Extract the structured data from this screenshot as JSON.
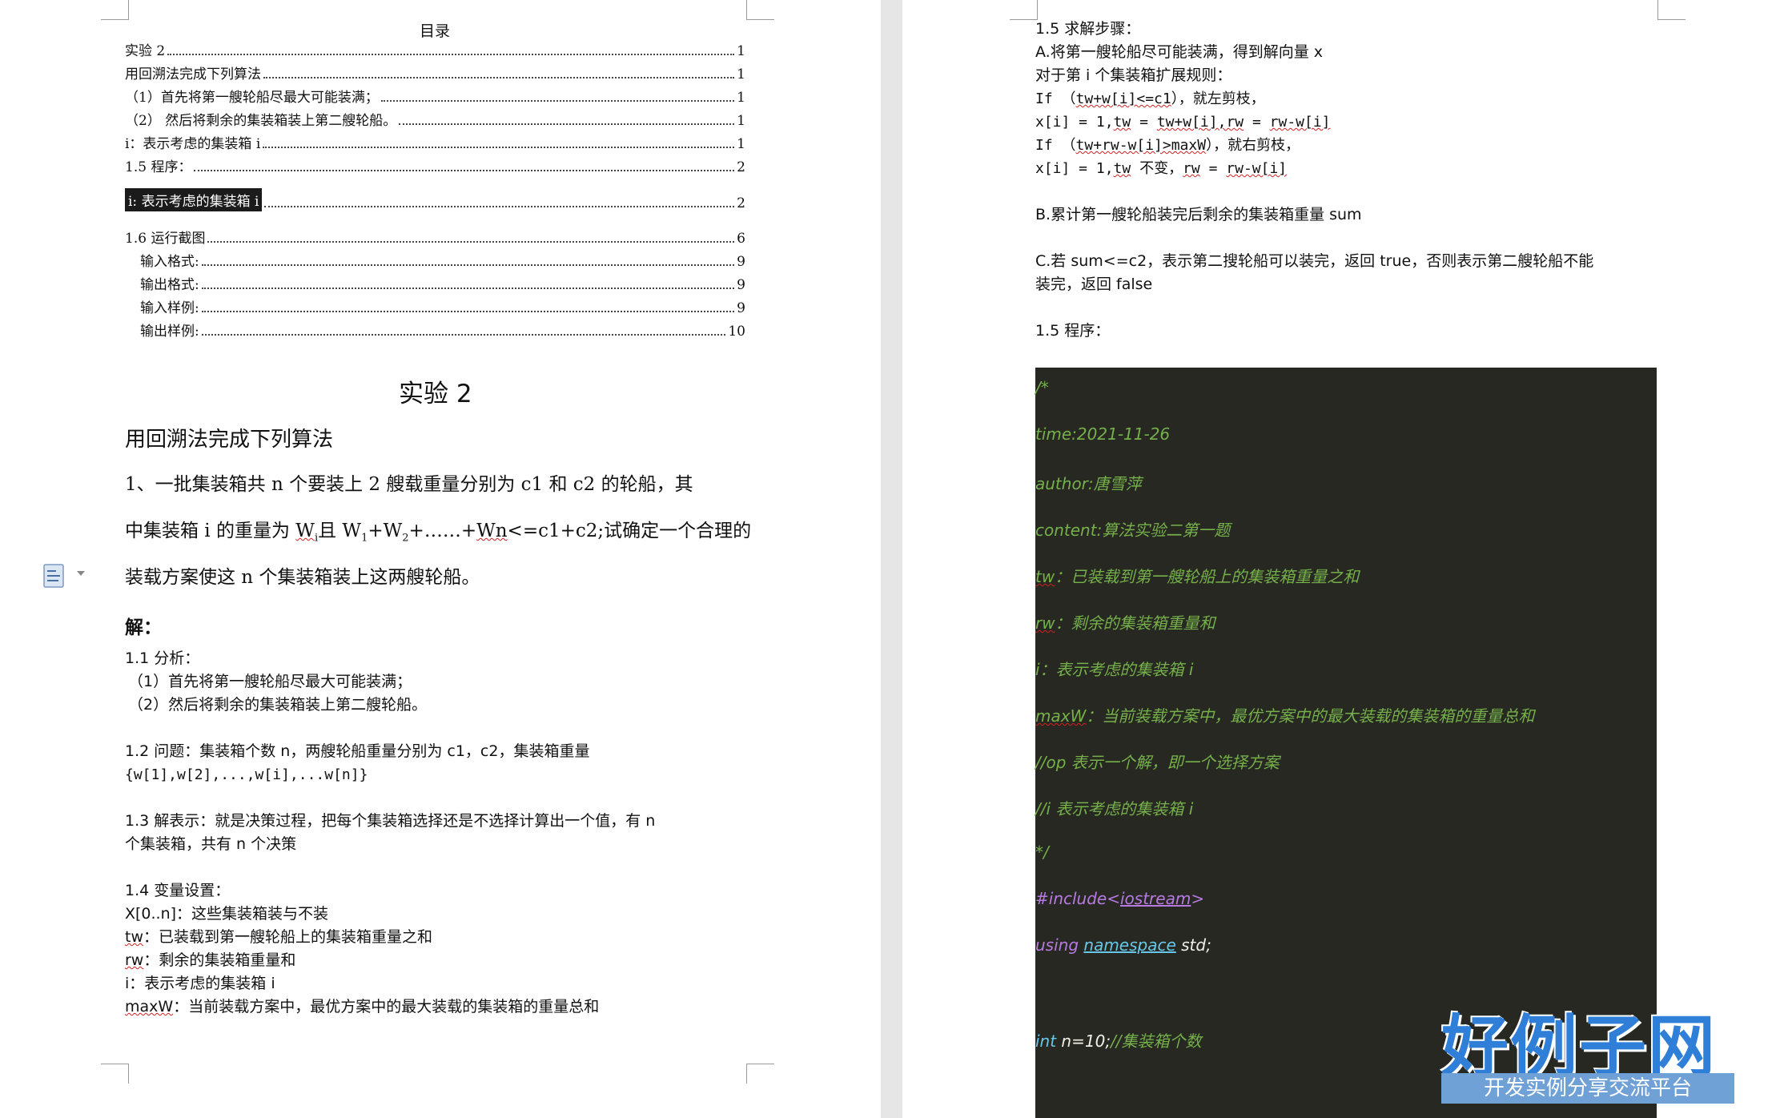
{
  "toc": {
    "title": "目录",
    "entries": [
      {
        "label": "实验 2",
        "page": "1"
      },
      {
        "label": "用回溯法完成下列算法",
        "page": "1"
      },
      {
        "label": "（1）首先将第一艘轮船尽最大可能装满；",
        "page": "1"
      },
      {
        "label": "（2） 然后将剩余的集装箱装上第二艘轮船。",
        "page": "1"
      },
      {
        "label": "i：表示考虑的集装箱 i",
        "page": "1"
      },
      {
        "label": "1.5 程序：",
        "page": "2"
      },
      {
        "label": "i: 表示考虑的集装箱 i",
        "page": "2"
      },
      {
        "label": "1.6 运行截图",
        "page": "6"
      },
      {
        "label": "输入格式:",
        "page": "9"
      },
      {
        "label": "输出格式:",
        "page": "9"
      },
      {
        "label": "输入样例:",
        "page": "9"
      },
      {
        "label": "输出样例:",
        "page": "10"
      }
    ]
  },
  "doc": {
    "h1": "实验 2",
    "h2": "用回溯法完成下列算法",
    "problem_line1": "1、一批集装箱共 n 个要装上 2 艘载重量分别为 c1 和 c2 的轮船，其",
    "problem_line2_a": "中集装箱 i 的重量为 ",
    "problem_line2_w": "W",
    "problem_line2_b": "且 W",
    "problem_line2_c": "+W",
    "problem_line2_d": "+……+",
    "problem_line2_wn": "Wn",
    "problem_line2_e": "<=c1+c2;试确定一个合理的",
    "sub_i": "i",
    "sub_1": "1",
    "sub_2": "2",
    "problem_line3": "装载方案使这 n 个集装箱装上这两艘轮船。",
    "solve": "解：",
    "s11": "1.1 分析：",
    "s11a": "（1）首先将第一艘轮船尽最大可能装满；",
    "s11b": "（2）然后将剩余的集装箱装上第二艘轮船。",
    "s12": "1.2 问题：集装箱个数 n，两艘轮船重量分别为 c1，c2，集装箱重量",
    "s12b": "{w[1],w[2],...,w[i],...w[n]}",
    "s13": "1.3 解表示：就是决策过程，把每个集装箱选择还是不选择计算出一个值，有 n",
    "s13b": "个集装箱，共有 n 个决策",
    "s14": "1.4 变量设置：",
    "s14a": "X[0..n]：这些集装箱装与不装",
    "s14b_k": "tw",
    "s14b": "：已装载到第一艘轮船上的集装箱重量之和",
    "s14c_k": "rw",
    "s14c": "：剩余的集装箱重量和",
    "s14d": "i：表示考虑的集装箱 i",
    "s14e_k": "maxW",
    "s14e": "：当前装载方案中，最优方案中的最大装载的集装箱的重量总和"
  },
  "right": {
    "s15": "1.5 求解步骤：",
    "a1": "A.将第一艘轮船尽可能装满，得到解向量 x",
    "a2": "对于第 i 个集装箱扩展规则：",
    "a3_a": "If （",
    "a3_k": "tw+w[i]<=c1",
    "a3_b": "），就左剪枝，",
    "a4_a": "x[i] = 1,",
    "a4_k1": "tw",
    "a4_b": " = ",
    "a4_k2": "tw+w[i],rw",
    "a4_c": " = ",
    "a4_k3": "rw-w[i]",
    "a5_a": "If （",
    "a5_k": "tw+rw-w[i]>maxW",
    "a5_b": "），就右剪枝，",
    "a6_a": "x[i] = 1,",
    "a6_k1": "tw",
    "a6_b": " 不变，",
    "a6_k2": "rw",
    "a6_c": " = ",
    "a6_k3": "rw-w[i]",
    "b1": "B.累计第一艘轮船装完后剩余的集装箱重量 sum",
    "c1": "C.若 sum<=c2，表示第二搜轮船可以装完，返回 true，否则表示第二艘轮船不能",
    "c2": "装完，返回 false",
    "prog": "1.5 程序："
  },
  "code": {
    "l1": "/*",
    "l2": "time:2021-11-26",
    "l3": "author:唐雪萍",
    "l4": "content:算法实验二第一题",
    "l5_k": "tw",
    "l5": "：已装载到第一艘轮船上的集装箱重量之和",
    "l6_k": "rw",
    "l6": "：剩余的集装箱重量和",
    "l7": "i：表示考虑的集装箱 i",
    "l8_k": "maxW",
    "l8": "：当前装载方案中，最优方案中的最大装载的集装箱的重量总和",
    "l9": "//op 表示一个解，即一个选择方案",
    "l10": "//i 表示考虑的集装箱 i",
    "l11": "*/",
    "l12_a": "#include<",
    "l12_b": "iostream",
    "l12_c": ">",
    "l13_a": "using ",
    "l13_b": "namespace",
    "l13_c": " std;",
    "l14_a": "int",
    "l14_b": " n=10;",
    "l14_c": "//集装箱个数"
  },
  "watermark": {
    "logo": "好例子网",
    "tagline": "开发实例分享交流平台"
  }
}
